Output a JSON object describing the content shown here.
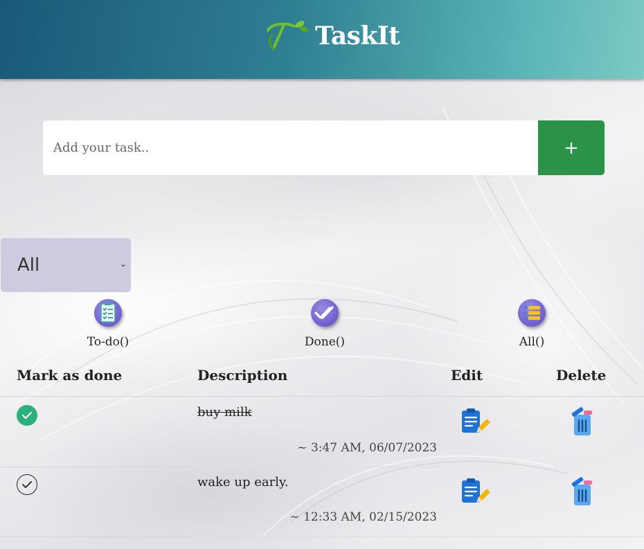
{
  "header": {
    "title": "TaskIt",
    "logo_icon": "leaf-t-logo-icon"
  },
  "task_input": {
    "placeholder": "Add your task..",
    "value": "",
    "add_label": "+"
  },
  "filter": {
    "selected": "All"
  },
  "categories": [
    {
      "label": "To-do()",
      "icon": "checklist-icon"
    },
    {
      "label": "Done()",
      "icon": "double-check-icon"
    },
    {
      "label": "All()",
      "icon": "list-icon"
    }
  ],
  "table": {
    "headers": {
      "mark": "Mark as done",
      "description": "Description",
      "edit": "Edit",
      "delete": "Delete"
    },
    "rows": [
      {
        "done": true,
        "description": "buy milk",
        "timestamp": "~ 3:47 AM, 06/07/2023"
      },
      {
        "done": false,
        "description": "wake up early.",
        "timestamp": "~ 12:33 AM, 02/15/2023"
      }
    ]
  },
  "colors": {
    "header_start": "#1a5878",
    "header_end": "#7ccac4",
    "add_button": "#2a9348",
    "filter_bg": "#cccbdf",
    "check_done": "#2bb07e",
    "category_icon": "#6a5acd"
  }
}
